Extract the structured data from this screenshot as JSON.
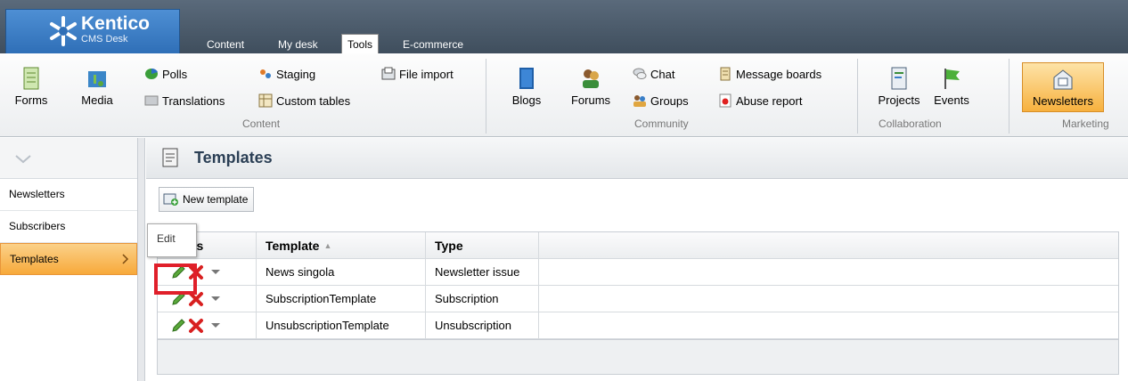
{
  "brand": {
    "name": "Kentico",
    "sub": "CMS Desk"
  },
  "tabs": [
    "Content",
    "My desk",
    "Tools",
    "E-commerce"
  ],
  "ribbon": {
    "forms": "Forms",
    "media": "Media",
    "polls": "Polls",
    "staging": "Staging",
    "file_import": "File import",
    "translations": "Translations",
    "custom_tables": "Custom tables",
    "group_content": "Content",
    "blogs": "Blogs",
    "forums": "Forums",
    "chat": "Chat",
    "groups": "Groups",
    "message_boards": "Message boards",
    "abuse_report": "Abuse report",
    "group_community": "Community",
    "projects": "Projects",
    "events": "Events",
    "group_collaboration": "Collaboration",
    "newsletters": "Newsletters",
    "group_marketing": "Marketing"
  },
  "nav": {
    "items": [
      "Newsletters",
      "Subscribers",
      "Templates"
    ]
  },
  "page": {
    "title": "Templates",
    "new_button": "New template"
  },
  "grid": {
    "headers": {
      "actions": "Actions",
      "template": "Template",
      "type": "Type"
    },
    "rows": [
      {
        "template": "News singola",
        "type": "Newsletter issue"
      },
      {
        "template": "SubscriptionTemplate",
        "type": "Subscription"
      },
      {
        "template": "UnsubscriptionTemplate",
        "type": "Unsubscription"
      }
    ]
  },
  "tooltip": "Edit",
  "colors": {
    "accent": "#f7a93a",
    "highlight": "#e01f2a",
    "topbar": "#4a5968"
  }
}
